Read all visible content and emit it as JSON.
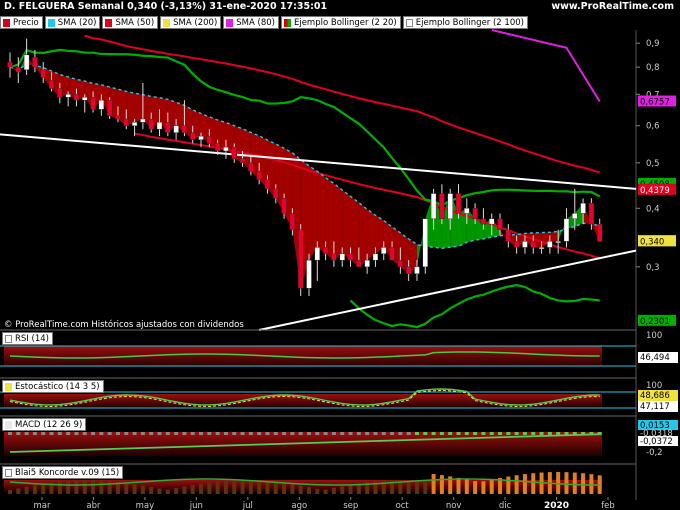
{
  "header": {
    "title": "D. FELGUERA Semanal 0,340 (-3,13%) 31-ene-2020 17:35:01",
    "brand": "www.ProRealTime.com"
  },
  "legend": [
    {
      "label": "Precio",
      "color": "#d00020",
      "kind": "solid"
    },
    {
      "label": "SMA (20)",
      "color": "#22c8e8",
      "kind": "solid"
    },
    {
      "label": "SMA (50)",
      "color": "#e00020",
      "kind": "solid"
    },
    {
      "label": "SMA (200)",
      "color": "#f0e040",
      "kind": "solid"
    },
    {
      "label": "SMA (80)",
      "color": "#e020e0",
      "kind": "solid"
    },
    {
      "label": "Ejemplo Bollinger (2 20)",
      "color": "",
      "kind": "bb"
    },
    {
      "label": "Ejemplo Bollinger (2 100)",
      "color": "",
      "kind": "empty"
    }
  ],
  "copyright": "© ProRealTime.com  Históricos ajustados con dividendos",
  "panels": {
    "rsi": {
      "label": "RSI (14)",
      "top_value": "100",
      "value": "46,494",
      "color": "#e8e8e8"
    },
    "stoch": {
      "label": "Estocástico (14 3 5)",
      "top_value": "100",
      "value1": "48,686",
      "value2": "47,117",
      "color1": "#f0e040",
      "color2": "#ffffff"
    },
    "macd": {
      "label": "MACD (12 26 9)",
      "value1": "0,0153",
      "value2": "-0,0318",
      "value3": "-0,0372",
      "tick": "-0,2"
    },
    "blai": {
      "label": "Blai5 Koncorde v.09 (15)"
    }
  },
  "colors": {
    "up_candle": "#ffffff",
    "down_candle": "#e8002a",
    "bb_green": "#00b000",
    "bb_red": "#c00000",
    "sma20": "#22c8e8",
    "sma50": "#e00020",
    "sma80": "#e020e0",
    "trendline": "#ffffff"
  },
  "chart_data": {
    "type": "candlestick",
    "title": "D. FELGUERA Semanal",
    "x_labels": [
      "mar",
      "abr",
      "may",
      "jun",
      "jul",
      "ago",
      "sep",
      "oct",
      "nov",
      "dic",
      "2020",
      "feb"
    ],
    "y_ticks": [
      "0,9",
      "0,8",
      "0,7",
      "0,6",
      "0,5",
      "0,4",
      "0,3"
    ],
    "ylim": [
      0.22,
      0.96
    ],
    "y_scale": "log",
    "value_tags": [
      {
        "label": "0,6757",
        "value": 0.6757,
        "color": "#e020e0",
        "text": "#000000"
      },
      {
        "label": "0,4508",
        "value": 0.4508,
        "color": "#00b000",
        "text": "#000000"
      },
      {
        "label": "0,4379",
        "value": 0.4379,
        "color": "#e00020",
        "text": "#ffffff"
      },
      {
        "label": "0,3404",
        "value": 0.3404,
        "color": "#22c8e8",
        "text": "#000000"
      },
      {
        "label": "0,340",
        "value": 0.34,
        "color": "#f0e040",
        "text": "#000000"
      },
      {
        "label": "0,2301",
        "value": 0.2301,
        "color": "#00b000",
        "text": "#000000"
      }
    ],
    "ohlc": [
      [
        0.82,
        0.86,
        0.76,
        0.8
      ],
      [
        0.8,
        0.84,
        0.74,
        0.78
      ],
      [
        0.79,
        0.92,
        0.77,
        0.85
      ],
      [
        0.84,
        0.87,
        0.78,
        0.8
      ],
      [
        0.79,
        0.82,
        0.74,
        0.76
      ],
      [
        0.75,
        0.78,
        0.71,
        0.72
      ],
      [
        0.72,
        0.74,
        0.67,
        0.69
      ],
      [
        0.69,
        0.71,
        0.66,
        0.7
      ],
      [
        0.7,
        0.72,
        0.66,
        0.68
      ],
      [
        0.68,
        0.7,
        0.64,
        0.69
      ],
      [
        0.69,
        0.71,
        0.64,
        0.65
      ],
      [
        0.65,
        0.7,
        0.63,
        0.68
      ],
      [
        0.68,
        0.69,
        0.62,
        0.63
      ],
      [
        0.63,
        0.66,
        0.61,
        0.62
      ],
      [
        0.62,
        0.65,
        0.59,
        0.6
      ],
      [
        0.6,
        0.62,
        0.57,
        0.61
      ],
      [
        0.61,
        0.74,
        0.59,
        0.62
      ],
      [
        0.62,
        0.64,
        0.58,
        0.59
      ],
      [
        0.59,
        0.65,
        0.57,
        0.61
      ],
      [
        0.61,
        0.64,
        0.57,
        0.58
      ],
      [
        0.58,
        0.62,
        0.56,
        0.6
      ],
      [
        0.6,
        0.68,
        0.57,
        0.58
      ],
      [
        0.58,
        0.6,
        0.55,
        0.56
      ],
      [
        0.56,
        0.58,
        0.54,
        0.57
      ],
      [
        0.57,
        0.59,
        0.54,
        0.55
      ],
      [
        0.55,
        0.56,
        0.52,
        0.53
      ],
      [
        0.53,
        0.56,
        0.51,
        0.54
      ],
      [
        0.54,
        0.55,
        0.5,
        0.51
      ],
      [
        0.51,
        0.53,
        0.49,
        0.5
      ],
      [
        0.5,
        0.52,
        0.47,
        0.48
      ],
      [
        0.48,
        0.5,
        0.45,
        0.46
      ],
      [
        0.46,
        0.47,
        0.43,
        0.44
      ],
      [
        0.44,
        0.45,
        0.41,
        0.42
      ],
      [
        0.42,
        0.43,
        0.38,
        0.39
      ],
      [
        0.39,
        0.4,
        0.35,
        0.36
      ],
      [
        0.36,
        0.37,
        0.26,
        0.27
      ],
      [
        0.27,
        0.32,
        0.26,
        0.31
      ],
      [
        0.31,
        0.34,
        0.28,
        0.33
      ],
      [
        0.33,
        0.34,
        0.31,
        0.32
      ],
      [
        0.32,
        0.34,
        0.3,
        0.31
      ],
      [
        0.31,
        0.33,
        0.3,
        0.32
      ],
      [
        0.32,
        0.33,
        0.3,
        0.31
      ],
      [
        0.31,
        0.33,
        0.3,
        0.3
      ],
      [
        0.3,
        0.32,
        0.29,
        0.31
      ],
      [
        0.31,
        0.33,
        0.3,
        0.32
      ],
      [
        0.32,
        0.34,
        0.31,
        0.33
      ],
      [
        0.33,
        0.34,
        0.31,
        0.31
      ],
      [
        0.31,
        0.33,
        0.29,
        0.3
      ],
      [
        0.3,
        0.31,
        0.28,
        0.29
      ],
      [
        0.29,
        0.31,
        0.28,
        0.3
      ],
      [
        0.3,
        0.38,
        0.29,
        0.38
      ],
      [
        0.38,
        0.44,
        0.36,
        0.43
      ],
      [
        0.43,
        0.45,
        0.37,
        0.38
      ],
      [
        0.38,
        0.44,
        0.36,
        0.43
      ],
      [
        0.43,
        0.45,
        0.38,
        0.39
      ],
      [
        0.39,
        0.42,
        0.37,
        0.4
      ],
      [
        0.4,
        0.41,
        0.37,
        0.38
      ],
      [
        0.38,
        0.4,
        0.36,
        0.37
      ],
      [
        0.37,
        0.39,
        0.35,
        0.38
      ],
      [
        0.38,
        0.39,
        0.35,
        0.36
      ],
      [
        0.36,
        0.37,
        0.33,
        0.34
      ],
      [
        0.34,
        0.35,
        0.32,
        0.33
      ],
      [
        0.33,
        0.35,
        0.32,
        0.34
      ],
      [
        0.34,
        0.35,
        0.32,
        0.33
      ],
      [
        0.33,
        0.34,
        0.32,
        0.33
      ],
      [
        0.33,
        0.35,
        0.32,
        0.34
      ],
      [
        0.34,
        0.36,
        0.32,
        0.34
      ],
      [
        0.34,
        0.4,
        0.33,
        0.38
      ],
      [
        0.38,
        0.44,
        0.36,
        0.39
      ],
      [
        0.39,
        0.42,
        0.37,
        0.41
      ],
      [
        0.41,
        0.42,
        0.36,
        0.37
      ],
      [
        0.37,
        0.38,
        0.34,
        0.34
      ]
    ]
  }
}
